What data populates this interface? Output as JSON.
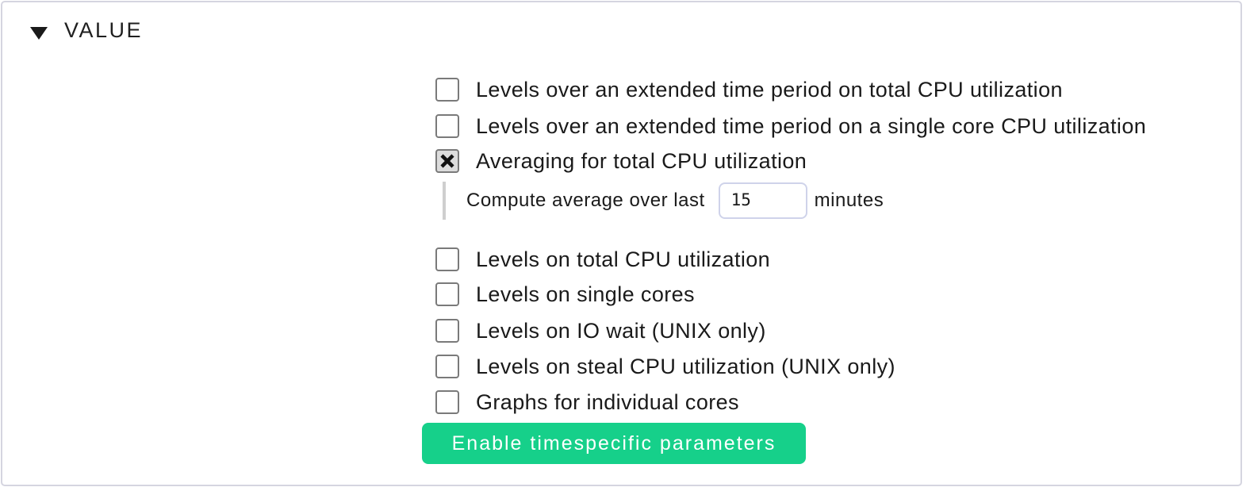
{
  "section": {
    "title": "VALUE",
    "toggle_icon": "triangle-down-icon"
  },
  "options": [
    {
      "label": "Levels over an extended time period on total CPU utilization",
      "checked": false
    },
    {
      "label": "Levels over an extended time period on a single core CPU utilization",
      "checked": false
    },
    {
      "label": "Averaging for total CPU utilization",
      "checked": true
    },
    {
      "label": "Levels on total CPU utilization",
      "checked": false
    },
    {
      "label": "Levels on single cores",
      "checked": false
    },
    {
      "label": "Levels on IO wait (UNIX only)",
      "checked": false
    },
    {
      "label": "Levels on steal CPU utilization (UNIX only)",
      "checked": false
    },
    {
      "label": "Graphs for individual cores",
      "checked": false
    }
  ],
  "averaging": {
    "prefix": "Compute average over last",
    "value": "15",
    "unit": "minutes"
  },
  "timespecific_button": {
    "label": "Enable timespecific parameters",
    "color": "#16d08a"
  }
}
